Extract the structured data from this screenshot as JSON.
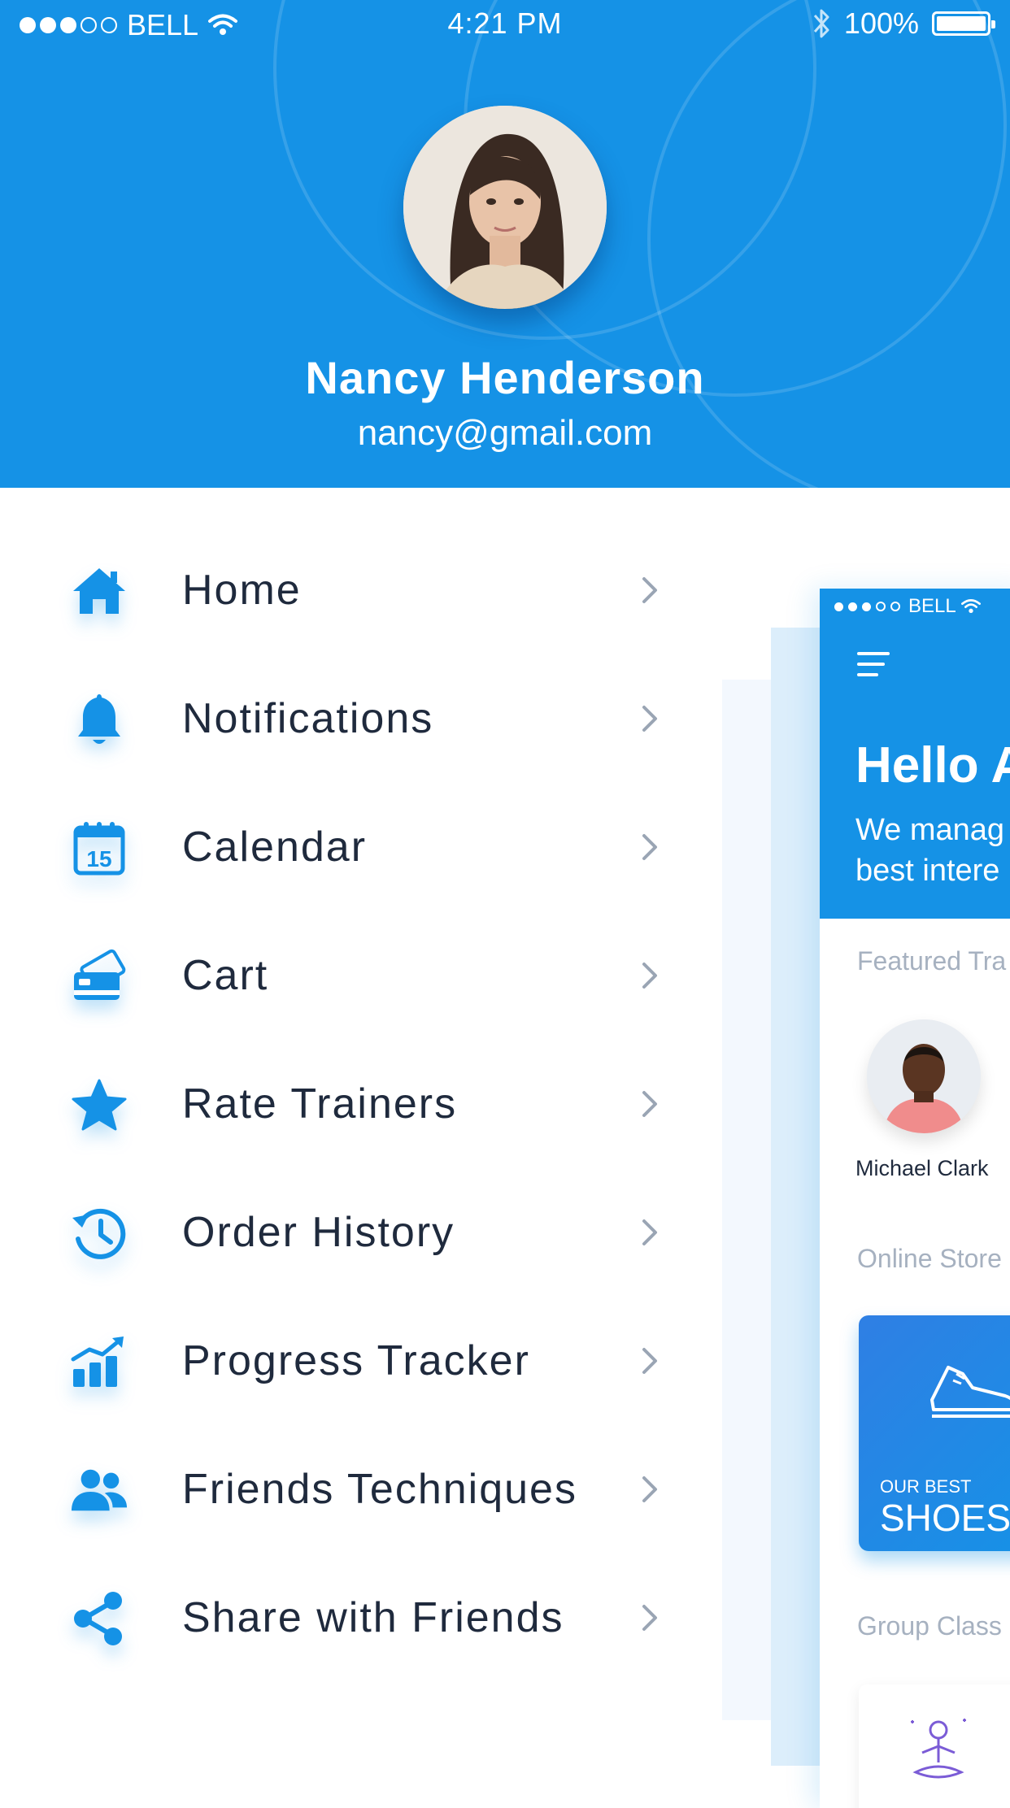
{
  "status_bar": {
    "carrier": "BELL",
    "time": "4:21 PM",
    "battery": "100%"
  },
  "profile": {
    "name": "Nancy Henderson",
    "email": "nancy@gmail.com"
  },
  "menu": {
    "items": [
      {
        "label": "Home",
        "icon": "home-icon"
      },
      {
        "label": "Notifications",
        "icon": "bell-icon"
      },
      {
        "label": "Calendar",
        "icon": "calendar-icon",
        "icon_text": "15"
      },
      {
        "label": "Cart",
        "icon": "cart-cards-icon"
      },
      {
        "label": "Rate Trainers",
        "icon": "star-icon"
      },
      {
        "label": "Order History",
        "icon": "history-icon"
      },
      {
        "label": "Progress Tracker",
        "icon": "chart-icon"
      },
      {
        "label": "Friends Techniques",
        "icon": "friends-icon"
      },
      {
        "label": "Share with Friends",
        "icon": "share-icon"
      }
    ]
  },
  "preview": {
    "status_carrier": "BELL",
    "hello": "Hello A",
    "tagline_line1": "We manag",
    "tagline_line2": "best intere",
    "featured_label": "Featured Tra",
    "trainer_name": "Michael Clark",
    "store_label": "Online Store",
    "card_small": "OUR BEST",
    "card_big": "SHOES",
    "group_label": "Group Class"
  },
  "colors": {
    "primary": "#1592e6",
    "text_dark": "#1f2a3d",
    "text_muted": "#a6b1c0",
    "chevron": "#9aa5b4"
  }
}
